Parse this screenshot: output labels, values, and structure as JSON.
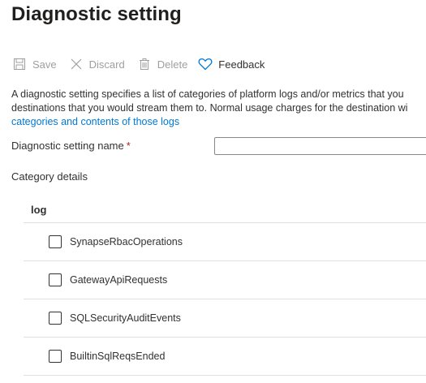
{
  "page": {
    "title": "Diagnostic setting"
  },
  "toolbar": {
    "save": {
      "label": "Save",
      "icon": "save-icon",
      "enabled": false
    },
    "discard": {
      "label": "Discard",
      "icon": "close-icon",
      "enabled": false
    },
    "delete": {
      "label": "Delete",
      "icon": "trash-icon",
      "enabled": false
    },
    "feedback": {
      "label": "Feedback",
      "icon": "heart-icon",
      "enabled": true
    }
  },
  "description": {
    "line1": "A diagnostic setting specifies a list of categories of platform logs and/or metrics that you",
    "line2": "destinations that you would stream them to. Normal usage charges for the destination wi",
    "link": "categories and contents of those logs"
  },
  "form": {
    "name_label": "Diagnostic setting name",
    "required_marker": "*",
    "name_value": ""
  },
  "category_details": {
    "heading": "Category details",
    "log_header": "log",
    "logs": [
      {
        "label": "SynapseRbacOperations",
        "checked": false
      },
      {
        "label": "GatewayApiRequests",
        "checked": false
      },
      {
        "label": "SQLSecurityAuditEvents",
        "checked": false
      },
      {
        "label": "BuiltinSqlReqsEnded",
        "checked": false
      }
    ]
  },
  "colors": {
    "link": "#0078d4",
    "accent": "#0078d4",
    "disabled_text": "#a19f9d",
    "required": "#a4262c",
    "divider": "#e1dfdd"
  }
}
